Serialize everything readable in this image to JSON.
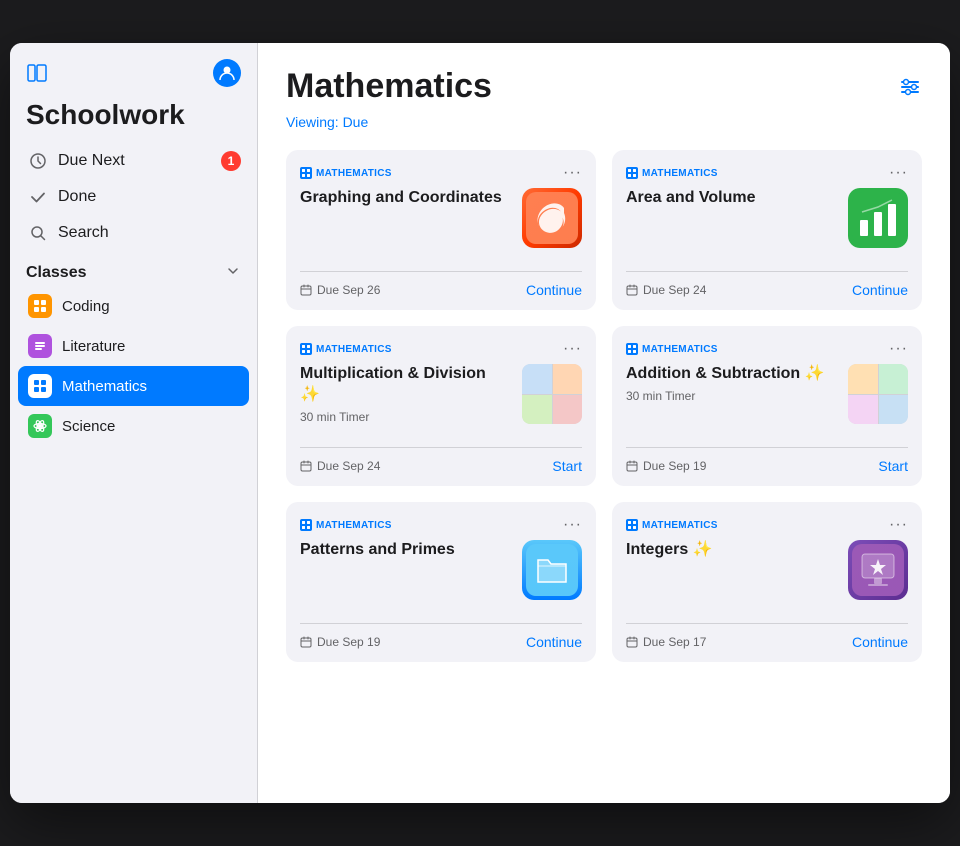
{
  "app": {
    "title": "Schoolwork",
    "window_toggle_icon": "⊞",
    "avatar_icon": "👤"
  },
  "sidebar": {
    "nav_items": [
      {
        "id": "due-next",
        "label": "Due Next",
        "icon": "clock",
        "badge": "1"
      },
      {
        "id": "done",
        "label": "Done",
        "icon": "check"
      },
      {
        "id": "search",
        "label": "Search",
        "icon": "search"
      }
    ],
    "classes_section": {
      "title": "Classes",
      "items": [
        {
          "id": "coding",
          "label": "Coding",
          "icon": "orange-grid",
          "active": false
        },
        {
          "id": "literature",
          "label": "Literature",
          "icon": "purple-bars",
          "active": false
        },
        {
          "id": "mathematics",
          "label": "Mathematics",
          "icon": "blue-grid",
          "active": true
        },
        {
          "id": "science",
          "label": "Science",
          "icon": "green-atom",
          "active": false
        }
      ]
    }
  },
  "main": {
    "title": "Mathematics",
    "viewing_prefix": "Viewing:",
    "viewing_value": "Due",
    "filter_icon": "sliders",
    "cards": [
      {
        "id": "card-graphing",
        "subject": "MATHEMATICS",
        "title": "Graphing and Coordinates",
        "subtitle": "",
        "timer": "",
        "due": "Due Sep 26",
        "action": "Continue",
        "thumbnail_type": "swift"
      },
      {
        "id": "card-area",
        "subject": "MATHEMATICS",
        "title": "Area and Volume",
        "subtitle": "",
        "timer": "",
        "due": "Due Sep 24",
        "action": "Continue",
        "thumbnail_type": "numbers"
      },
      {
        "id": "card-multiply",
        "subject": "MATHEMATICS",
        "title": "Multiplication & Division ✨",
        "subtitle": "30 min Timer",
        "timer": "30 min Timer",
        "due": "Due Sep 24",
        "action": "Start",
        "thumbnail_type": "multiply"
      },
      {
        "id": "card-addition",
        "subject": "MATHEMATICS",
        "title": "Addition & Subtraction ✨",
        "subtitle": "30 min Timer",
        "timer": "30 min Timer",
        "due": "Due Sep 19",
        "action": "Start",
        "thumbnail_type": "add"
      },
      {
        "id": "card-patterns",
        "subject": "MATHEMATICS",
        "title": "Patterns and Primes",
        "subtitle": "",
        "timer": "",
        "due": "Due Sep 19",
        "action": "Continue",
        "thumbnail_type": "files"
      },
      {
        "id": "card-integers",
        "subject": "MATHEMATICS",
        "title": "Integers ✨",
        "subtitle": "",
        "timer": "",
        "due": "Due Sep 17",
        "action": "Continue",
        "thumbnail_type": "keynote"
      }
    ]
  }
}
